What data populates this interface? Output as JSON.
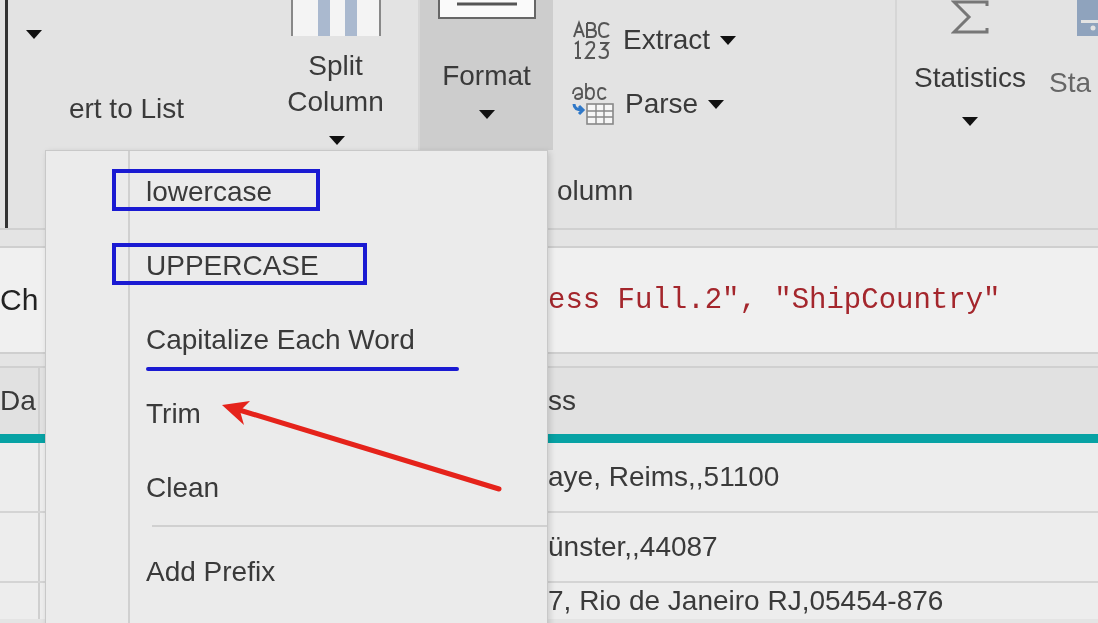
{
  "ribbon": {
    "convert_to_list": {
      "label": "ert to List"
    },
    "split_column": {
      "label": "Split Column"
    },
    "format": {
      "label": "Format",
      "pressed": true
    },
    "extract": {
      "label": "Extract"
    },
    "parse": {
      "label": "Parse"
    },
    "group_label": "olumn",
    "statistics": {
      "label": "Statistics"
    },
    "standard": {
      "label": "Sta"
    }
  },
  "formula_bar": {
    "left_text": "Ch",
    "text": "ess Full.2\", \"ShipCountry\""
  },
  "table": {
    "columns": [
      "Da",
      "ss"
    ],
    "rows": [
      {
        "column_2": "aye, Reims,,51100"
      },
      {
        "column_2": "ünster,,44087"
      },
      {
        "column_2": "7, Rio de Janeiro RJ,05454-876"
      }
    ]
  },
  "format_menu": {
    "items": [
      {
        "kind": "item",
        "label": "lowercase",
        "boxed": true,
        "underlined": false,
        "arrow": false
      },
      {
        "kind": "item",
        "label": "UPPERCASE",
        "boxed": true,
        "underlined": false,
        "arrow": false
      },
      {
        "kind": "item",
        "label": "Capitalize Each Word",
        "boxed": false,
        "underlined": true,
        "arrow": false
      },
      {
        "kind": "item",
        "label": "Trim",
        "boxed": false,
        "underlined": false,
        "arrow": true
      },
      {
        "kind": "item",
        "label": "Clean",
        "boxed": false,
        "underlined": false,
        "arrow": false
      },
      {
        "kind": "separator"
      },
      {
        "kind": "item",
        "label": "Add Prefix",
        "boxed": false,
        "underlined": false,
        "arrow": false
      }
    ]
  }
}
